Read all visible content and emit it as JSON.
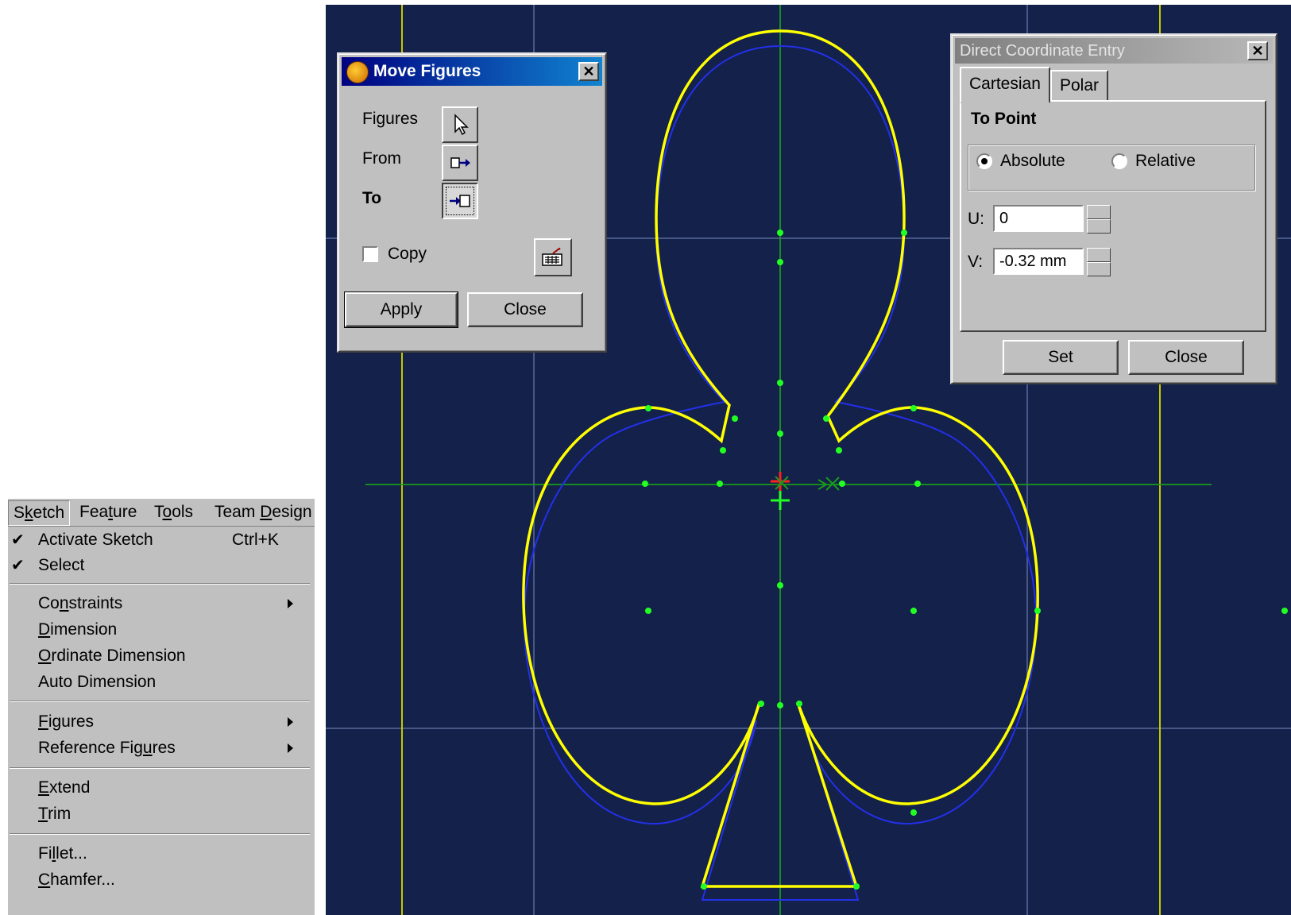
{
  "menubar": {
    "items": [
      {
        "label": "Sketch",
        "mnemonic_index": 1
      },
      {
        "label": "Feature",
        "mnemonic_index": 3
      },
      {
        "label": "Tools",
        "mnemonic_index": 1
      },
      {
        "label": "Team Design",
        "mnemonic_index": 5
      }
    ]
  },
  "sketch_menu": {
    "activate_sketch": {
      "label": "Activate Sketch",
      "shortcut": "Ctrl+K",
      "checked": true
    },
    "select": {
      "label": "Select",
      "checked": true
    },
    "constraints": {
      "label": "Constraints"
    },
    "dimension": {
      "label": "Dimension"
    },
    "ordinate_dimension": {
      "label": "Ordinate Dimension"
    },
    "auto_dimension": {
      "label": "Auto Dimension"
    },
    "figures": {
      "label": "Figures"
    },
    "reference_figures": {
      "label": "Reference Figures"
    },
    "extend": {
      "label": "Extend"
    },
    "trim": {
      "label": "Trim"
    },
    "fillet": {
      "label": "Fillet..."
    },
    "chamfer": {
      "label": "Chamfer..."
    }
  },
  "move_figures": {
    "title": "Move Figures",
    "figures_label": "Figures",
    "from_label": "From",
    "to_label": "To",
    "copy_label": "Copy",
    "copy_checked": false,
    "apply_label": "Apply",
    "close_label": "Close"
  },
  "coord_entry": {
    "title": "Direct Coordinate Entry",
    "tabs": [
      "Cartesian",
      "Polar"
    ],
    "active_tab": "Cartesian",
    "section_title": "To Point",
    "absolute_label": "Absolute",
    "relative_label": "Relative",
    "mode": "Absolute",
    "u_label": "U:",
    "u_value": "0",
    "v_label": "V:",
    "v_value": "-0.32 mm",
    "set_label": "Set",
    "close_label": "Close"
  },
  "colors": {
    "canvas_bg": "#13214b",
    "grid": "#5a6a99",
    "axis_yellow": "#c8c800",
    "axis_green": "#1a9a1a",
    "shape_yellow": "#ffff00",
    "shape_blue": "#2430e8",
    "point_green": "#22ff22",
    "origin_red": "#ff2020"
  }
}
